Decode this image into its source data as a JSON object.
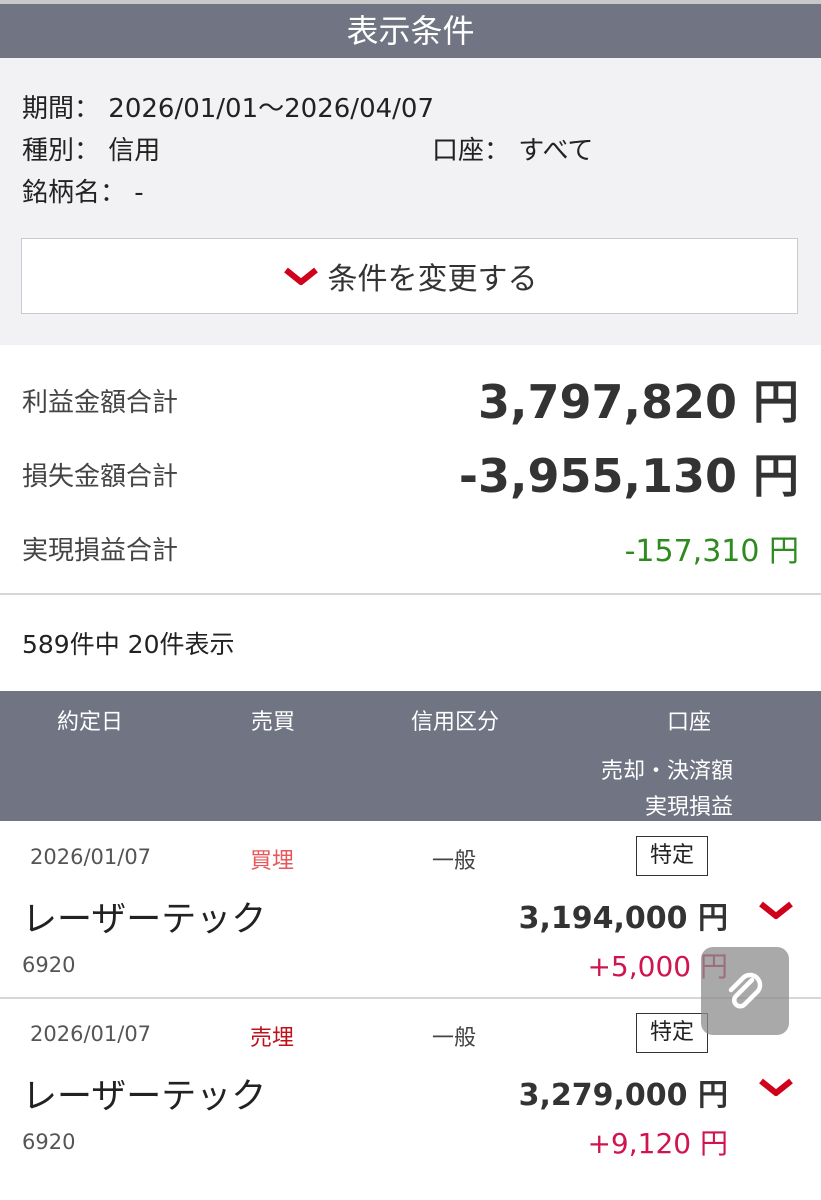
{
  "conditions": {
    "header": "表示条件",
    "period_label": "期間：",
    "period_value": "2026/01/01〜2026/04/07",
    "type_label": "種別：",
    "type_value": "信用",
    "account_label": "口座：",
    "account_value": "すべて",
    "stock_label": "銘柄名：",
    "stock_value": "-",
    "change_button": "条件を変更する"
  },
  "summary": {
    "profit_label": "利益金額合計",
    "profit_value": "3,797,820 円",
    "loss_label": "損失金額合計",
    "loss_value": "-3,955,130 円",
    "realized_label": "実現損益合計",
    "realized_value": "-157,310 円"
  },
  "count_text": "589件中 20件表示",
  "table_headers": {
    "trade_date": "約定日",
    "side": "売買",
    "credit_type": "信用区分",
    "account": "口座",
    "amount": "売却・決済額",
    "pnl": "実現損益"
  },
  "rows": [
    {
      "date": "2026/01/07",
      "side": "買埋",
      "credit_type": "一般",
      "account": "特定",
      "name": "レーザーテック",
      "code": "6920",
      "amount": "3,194,000 円",
      "pnl": "+5,000 円"
    },
    {
      "date": "2026/01/07",
      "side": "売埋",
      "credit_type": "一般",
      "account": "特定",
      "name": "レーザーテック",
      "code": "6920",
      "amount": "3,279,000 円",
      "pnl": "+9,120 円"
    }
  ],
  "colors": {
    "header_bg": "#717483",
    "accent_red": "#d0021b",
    "buy_side": "#e8565a",
    "sell_side": "#c0101a",
    "negative_green": "#2e8b1e",
    "positive_pnl": "#d0144f"
  },
  "icons": {
    "expand": "chevron-down-icon",
    "floating": "paperclip-icon"
  }
}
